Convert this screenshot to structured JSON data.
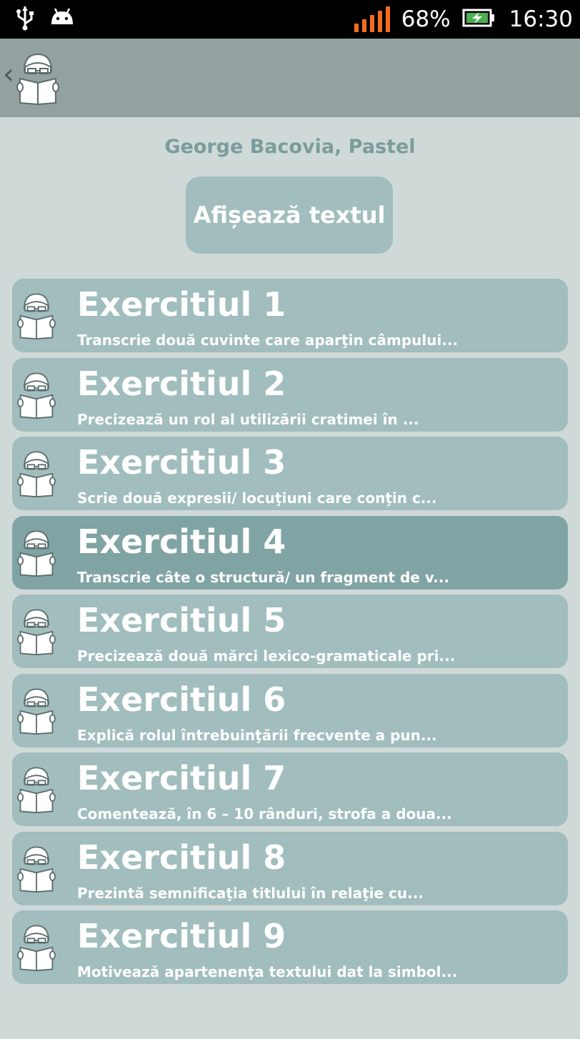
{
  "status_bar": {
    "battery_percent": "68%",
    "time": "16:30",
    "icons": [
      "usb-icon",
      "android-debug-icon",
      "signal-icon",
      "battery-charging-icon"
    ]
  },
  "action_bar": {
    "back_icon": "chevron-left-icon",
    "app_icon": "reader-with-book-icon"
  },
  "main": {
    "title": "George Bacovia, Pastel",
    "show_text_button": "Afișează textul"
  },
  "exercises": [
    {
      "title": "Exercitiul 1",
      "preview": "Transcrie două cuvinte care aparţin câmpului..."
    },
    {
      "title": "Exercitiul 2",
      "preview": "Precizează un rol al utilizării cratimei în ..."
    },
    {
      "title": "Exercitiul 3",
      "preview": "Scrie două expresii/ locuţiuni care conţin c..."
    },
    {
      "title": "Exercitiul 4",
      "preview": "Transcrie câte o structură/ un fragment de v..."
    },
    {
      "title": "Exercitiul 5",
      "preview": "Precizează două mărci lexico-gramaticale pri..."
    },
    {
      "title": "Exercitiul 6",
      "preview": "Explică rolul întrebuinţării frecvente a pun..."
    },
    {
      "title": "Exercitiul 7",
      "preview": "Comentează, în 6 – 10 rânduri, strofa a doua..."
    },
    {
      "title": "Exercitiul 8",
      "preview": "Prezintă semnificaţia titlului în relaţie cu..."
    },
    {
      "title": "Exercitiul 9",
      "preview": "Motivează apartenenţa textului dat la simbol..."
    }
  ],
  "colors": {
    "background": "#cfd9d8",
    "action_bar": "#93a1a1",
    "item": "#a1bdbd",
    "item_selected": "#80a4a3",
    "title_text": "#7b9c9c",
    "signal": "#f26b21"
  }
}
